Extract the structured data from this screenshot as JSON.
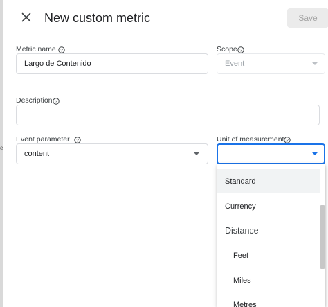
{
  "header": {
    "title": "New custom metric",
    "save_label": "Save"
  },
  "metric_name": {
    "label": "Metric name",
    "value": "Largo de Contenido"
  },
  "scope": {
    "label": "Scope",
    "value": "Event"
  },
  "description": {
    "label": "Description",
    "value": ""
  },
  "event_parameter": {
    "label": "Event parameter",
    "value": "content"
  },
  "unit_of_measurement": {
    "label": "Unit of measurement",
    "value": "",
    "options": [
      {
        "label": "Standard",
        "selected": true
      },
      {
        "label": "Currency"
      },
      {
        "label": "Distance",
        "group": true
      },
      {
        "label": "Feet"
      },
      {
        "label": "Miles"
      },
      {
        "label": "Metres"
      }
    ]
  },
  "colors": {
    "accent": "#1a73e8",
    "text": "#202124",
    "border": "#dadce0",
    "disabled_text": "#9aa0a6"
  },
  "icons": [
    "close-icon",
    "help-icon",
    "dropdown-arrow-icon"
  ]
}
